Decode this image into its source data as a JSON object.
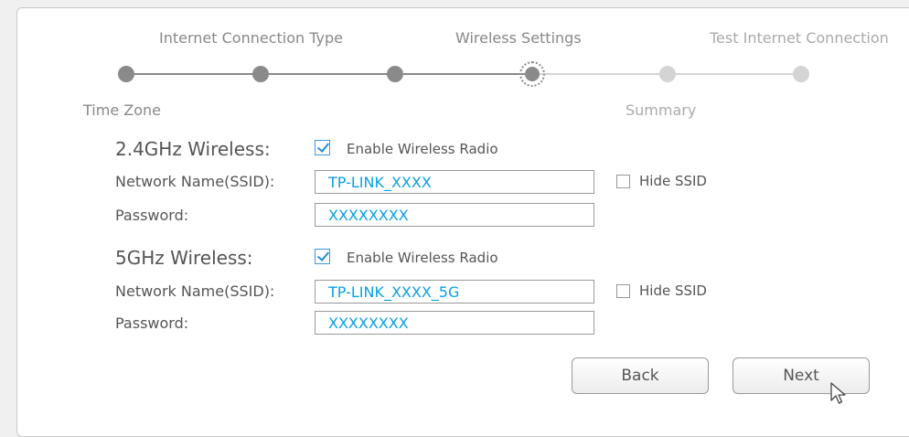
{
  "steps": {
    "top": [
      {
        "label": "Internet Connection Type"
      },
      {
        "label": "Wireless Settings"
      },
      {
        "label": "Test Internet Connection"
      }
    ],
    "bottom": [
      {
        "label": "Time Zone"
      },
      {
        "label": "Summary"
      }
    ],
    "current_step": "Wireless Settings",
    "total_steps": 6,
    "current_index": 4
  },
  "colors": {
    "done": "#8a8a8a",
    "todo": "#d4d4d4",
    "value_text": "#0aa0e4",
    "checkbox_check": "#1e8fde"
  },
  "band24": {
    "title": "2.4GHz Wireless:",
    "enable_label": "Enable Wireless Radio",
    "enabled": true,
    "ssid_label": "Network Name(SSID):",
    "ssid_value": "TP-LINK_XXXX",
    "hide_label": "Hide SSID",
    "hide_checked": false,
    "password_label": "Password:",
    "password_value": "XXXXXXXX"
  },
  "band5": {
    "title": "5GHz Wireless:",
    "enable_label": "Enable Wireless Radio",
    "enabled": true,
    "ssid_label": "Network Name(SSID):",
    "ssid_value": "TP-LINK_XXXX_5G",
    "hide_label": "Hide SSID",
    "hide_checked": false,
    "password_label": "Password:",
    "password_value": "XXXXXXXX"
  },
  "buttons": {
    "back": "Back",
    "next": "Next"
  }
}
